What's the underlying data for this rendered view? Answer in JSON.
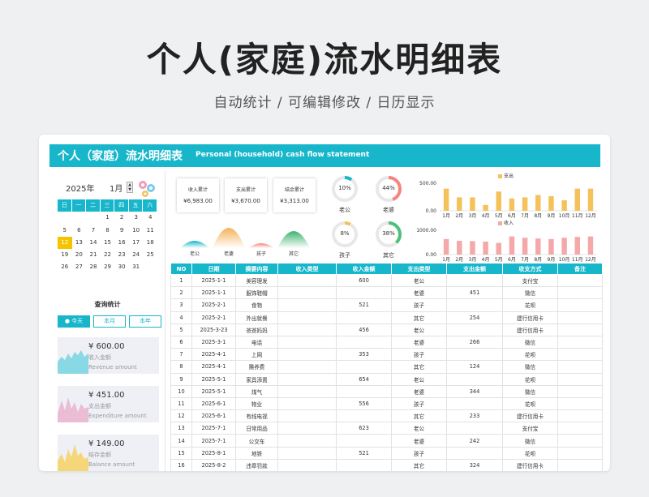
{
  "hero": {
    "title": "个人(家庭)流水明细表",
    "subtitle": "自动统计 /  可编辑修改 / 日历显示"
  },
  "banner": {
    "title": "个人（家庭）流水明细表",
    "subtitle": "Personal (household) cash flow statement"
  },
  "calendar": {
    "year": "2025年",
    "month": "1月",
    "weekdays": [
      "日",
      "一",
      "二",
      "三",
      "四",
      "五",
      "六"
    ],
    "rows": [
      [
        "",
        "",
        "",
        "1",
        "2",
        "3",
        "4"
      ],
      [
        "5",
        "6",
        "7",
        "8",
        "9",
        "10",
        "11"
      ],
      [
        "12",
        "13",
        "14",
        "15",
        "16",
        "17",
        "18"
      ],
      [
        "19",
        "20",
        "21",
        "22",
        "23",
        "24",
        "25"
      ],
      [
        "26",
        "27",
        "28",
        "29",
        "30",
        "31",
        ""
      ],
      [
        "",
        "",
        "",
        "",
        "",
        "",
        ""
      ]
    ],
    "today": "12"
  },
  "query": {
    "title": "查询统计",
    "buttons": [
      "今天",
      "本月",
      "本年"
    ]
  },
  "cards": [
    {
      "amount": "¥ 600.00",
      "cn": "收入金额",
      "en": "Revenue amount",
      "color": "#6fd3e0"
    },
    {
      "amount": "¥ 451.00",
      "cn": "支出金额",
      "en": "Expenditure amount",
      "color": "#e9a7c8"
    },
    {
      "amount": "¥ 149.00",
      "cn": "结存金额",
      "en": "Balance amount",
      "color": "#f5d36a"
    }
  ],
  "summary": [
    {
      "label": "收入累计",
      "value": "¥6,983.00"
    },
    {
      "label": "支出累计",
      "value": "¥3,670.00"
    },
    {
      "label": "结余累计",
      "value": "¥3,313.00"
    }
  ],
  "members": {
    "labels": [
      "老公",
      "老婆",
      "孩子",
      "其它"
    ]
  },
  "donuts": [
    {
      "pct": "10%",
      "label": "老公",
      "value": 0.1,
      "color": "#17b6cb"
    },
    {
      "pct": "44%",
      "label": "老婆",
      "value": 0.44,
      "color": "#f4867d"
    },
    {
      "pct": "8%",
      "label": "孩子",
      "value": 0.08,
      "color": "#f5c25a"
    },
    {
      "pct": "38%",
      "label": "其它",
      "value": 0.38,
      "color": "#4fc07a"
    }
  ],
  "chart_data": [
    {
      "type": "bar",
      "series": [
        {
          "name": "支出",
          "values": [
            380,
            230,
            230,
            100,
            330,
            210,
            230,
            270,
            250,
            180,
            380,
            380
          ],
          "color": "#f5c25a"
        }
      ],
      "categories": [
        "1月",
        "2月",
        "3月",
        "4月",
        "5月",
        "6月",
        "7月",
        "8月",
        "9月",
        "10月",
        "11月",
        "12月"
      ],
      "ylim": [
        0,
        500
      ],
      "yticks": [
        "500.00",
        "0.00"
      ]
    },
    {
      "type": "bar",
      "series": [
        {
          "name": "收入",
          "values": [
            600,
            530,
            520,
            500,
            450,
            700,
            650,
            620,
            600,
            650,
            680,
            700
          ],
          "color": "#f4a8a8"
        }
      ],
      "categories": [
        "1月",
        "2月",
        "3月",
        "4月",
        "5月",
        "6月",
        "7月",
        "8月",
        "9月",
        "10月",
        "11月",
        "12月"
      ],
      "ylim": [
        0,
        1000
      ],
      "yticks": [
        "1000.00",
        "0.00"
      ]
    }
  ],
  "table": {
    "headers": [
      "NO",
      "日期",
      "摘要内容",
      "收入类型",
      "收入金额",
      "支出类型",
      "支出金额",
      "收支方式",
      "备注"
    ],
    "rows": [
      [
        "1",
        "2025-1-1",
        "美容理发",
        "",
        "600",
        "老公",
        "",
        "支付宝",
        ""
      ],
      [
        "2",
        "2025-1-1",
        "服饰鞋帽",
        "",
        "",
        "老婆",
        "451",
        "微信",
        ""
      ],
      [
        "3",
        "2025-2-1",
        "食物",
        "",
        "521",
        "孩子",
        "",
        "花呗",
        ""
      ],
      [
        "4",
        "2025-2-1",
        "外出就餐",
        "",
        "",
        "其它",
        "254",
        "建行信用卡",
        ""
      ],
      [
        "5",
        "2025-3-23",
        "爸爸妈妈",
        "",
        "456",
        "老公",
        "",
        "建行信用卡",
        ""
      ],
      [
        "6",
        "2025-3-1",
        "电话",
        "",
        "",
        "老婆",
        "266",
        "微信",
        ""
      ],
      [
        "7",
        "2025-4-1",
        "上网",
        "",
        "353",
        "孩子",
        "",
        "花呗",
        ""
      ],
      [
        "8",
        "2025-4-1",
        "赡养费",
        "",
        "",
        "其它",
        "124",
        "微信",
        ""
      ],
      [
        "9",
        "2025-5-1",
        "家具添置",
        "",
        "654",
        "老公",
        "",
        "花呗",
        ""
      ],
      [
        "10",
        "2025-5-1",
        "煤气",
        "",
        "",
        "老婆",
        "344",
        "微信",
        ""
      ],
      [
        "11",
        "2025-6-1",
        "物业",
        "",
        "556",
        "孩子",
        "",
        "花呗",
        ""
      ],
      [
        "12",
        "2025-6-1",
        "有线电视",
        "",
        "",
        "其它",
        "233",
        "建行信用卡",
        ""
      ],
      [
        "13",
        "2025-7-1",
        "日常用品",
        "",
        "623",
        "老公",
        "",
        "支付宝",
        ""
      ],
      [
        "14",
        "2025-7-1",
        "公交车",
        "",
        "",
        "老婆",
        "242",
        "微信",
        ""
      ],
      [
        "15",
        "2025-8-1",
        "地铁",
        "",
        "521",
        "孩子",
        "",
        "花呗",
        ""
      ],
      [
        "16",
        "2025-8-2",
        "违章罚款",
        "",
        "",
        "其它",
        "324",
        "建行信用卡",
        ""
      ]
    ]
  }
}
